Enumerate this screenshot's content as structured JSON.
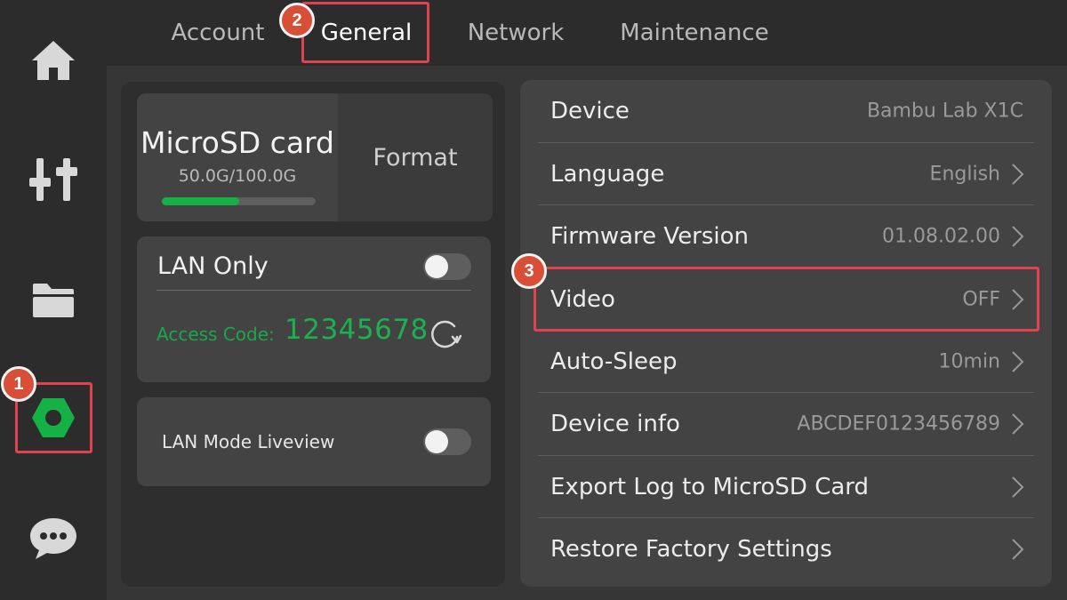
{
  "sidebar": {
    "items": [
      {
        "icon": "home-icon"
      },
      {
        "icon": "sliders-icon"
      },
      {
        "icon": "folder-icon"
      },
      {
        "icon": "settings-nut-icon",
        "active": true
      },
      {
        "icon": "chat-icon"
      }
    ]
  },
  "tabs": [
    {
      "label": "Account"
    },
    {
      "label": "General",
      "active": true
    },
    {
      "label": "Network"
    },
    {
      "label": "Maintenance"
    }
  ],
  "storage": {
    "title": "MicroSD card",
    "usage": "50.0G/100.0G",
    "fill_fraction": 0.5,
    "format_label": "Format"
  },
  "lan": {
    "title": "LAN Only",
    "toggle_on": false,
    "access_label": "Access Code:",
    "access_code": "12345678"
  },
  "liveview": {
    "label": "LAN Mode Liveview",
    "toggle_on": false
  },
  "settings": [
    {
      "label": "Device",
      "value": "Bambu Lab X1C"
    },
    {
      "label": "Language",
      "value": "English"
    },
    {
      "label": "Firmware Version",
      "value": "01.08.02.00"
    },
    {
      "label": "Video",
      "value": "OFF"
    },
    {
      "label": "Auto-Sleep",
      "value": "10min"
    },
    {
      "label": "Device info",
      "value": "ABCDEF0123456789"
    },
    {
      "label": "Export Log to MicroSD Card",
      "value": ""
    },
    {
      "label": "Restore Factory Settings",
      "value": ""
    }
  ],
  "annotations": [
    {
      "number": "1"
    },
    {
      "number": "2"
    },
    {
      "number": "3"
    }
  ],
  "colors": {
    "accent_green": "#15b144",
    "highlight_red": "#e0434f",
    "badge": "#d94e36"
  }
}
